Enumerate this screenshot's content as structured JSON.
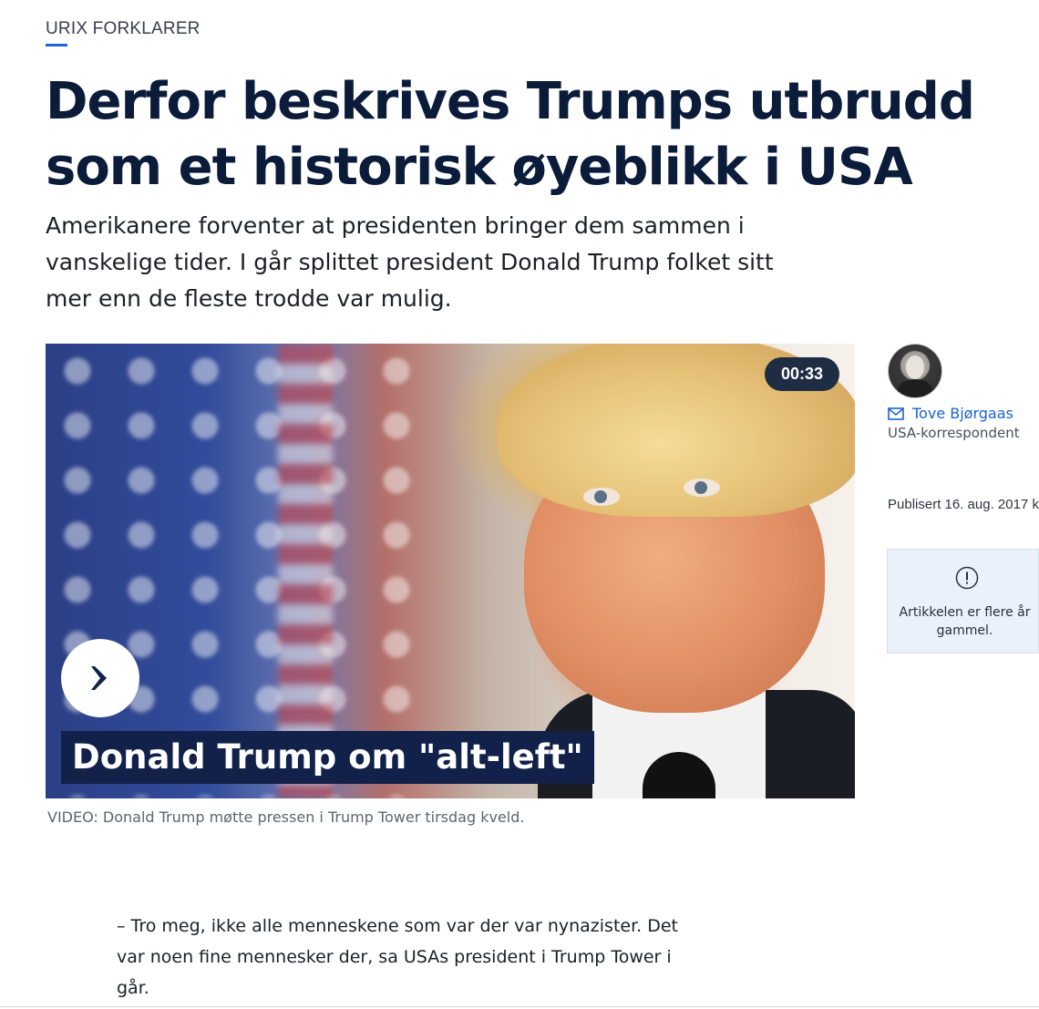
{
  "article": {
    "kicker": "URIX FORKLARER",
    "headline": "Derfor beskrives Trumps utbrudd som et historisk øyeblikk i USA",
    "lead": "Amerikanere forventer at presidenten bringer dem sammen i vanskelige tider. I går splittet president Donald Trump folket sitt mer enn de fleste trodde var mulig.",
    "body_paragraph": "– Tro meg, ikke alle menneskene som var der var nynazister. Det var noen fine mennesker der, sa USAs president i Trump Tower i går."
  },
  "video": {
    "duration": "00:33",
    "title": "Donald Trump om \"alt-left\"",
    "caption": "VIDEO: Donald Trump møtte pressen i Trump Tower tirsdag kveld.",
    "play_icon": "chevron-right-icon"
  },
  "byline": {
    "author_name": "Tove Bjørgaas",
    "author_role": "USA-korrespondent",
    "published": "Publisert 16. aug. 2017 k",
    "mail_icon": "mail-icon"
  },
  "notice": {
    "text": "Artikkelen er flere år gammel.",
    "icon": "exclamation-circle-icon"
  },
  "colors": {
    "accent": "#1b63d7",
    "headline": "#0b1b3a",
    "video_title_bg": "#112149",
    "notice_bg": "#eaf1fa"
  }
}
